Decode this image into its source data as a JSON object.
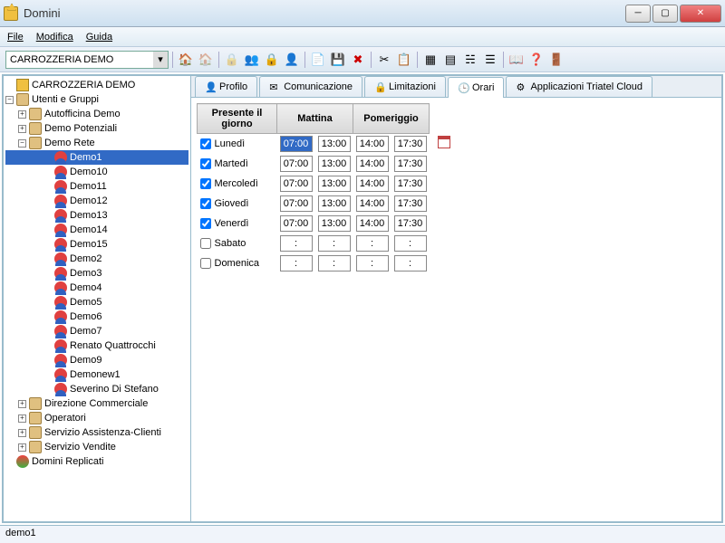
{
  "window": {
    "title": "Domini"
  },
  "menu": {
    "file": "File",
    "modifica": "Modifica",
    "guida": "Guida"
  },
  "toolbar": {
    "combo": "CARROZZERIA DEMO"
  },
  "tree": {
    "root": "CARROZZERIA DEMO",
    "utenti": "Utenti e Gruppi",
    "groups": [
      {
        "label": "Autofficina Demo"
      },
      {
        "label": "Demo Potenziali"
      },
      {
        "label": "Demo Rete",
        "expanded": true,
        "users": [
          "Demo1",
          "Demo10",
          "Demo11",
          "Demo12",
          "Demo13",
          "Demo14",
          "Demo15",
          "Demo2",
          "Demo3",
          "Demo4",
          "Demo5",
          "Demo6",
          "Demo7",
          "Renato Quattrocchi",
          "Demo9",
          "Demonew1",
          "Severino Di Stefano"
        ]
      },
      {
        "label": "Direzione Commerciale"
      },
      {
        "label": "Operatori"
      },
      {
        "label": "Servizio Assistenza-Clienti"
      },
      {
        "label": "Servizio Vendite"
      }
    ],
    "replicati": "Domini Replicati"
  },
  "tabs": {
    "profilo": "Profilo",
    "comunicazione": "Comunicazione",
    "limitazioni": "Limitazioni",
    "orari": "Orari",
    "cloud": "Applicazioni Triatel Cloud"
  },
  "schedule": {
    "headers": {
      "presente": "Presente il giorno",
      "mattina": "Mattina",
      "pomeriggio": "Pomeriggio"
    },
    "rows": [
      {
        "day": "Lunedì",
        "chk": true,
        "m1": "07:00",
        "m2": "13:00",
        "p1": "14:00",
        "p2": "17:30",
        "highlight": true
      },
      {
        "day": "Martedì",
        "chk": true,
        "m1": "07:00",
        "m2": "13:00",
        "p1": "14:00",
        "p2": "17:30"
      },
      {
        "day": "Mercoledì",
        "chk": true,
        "m1": "07:00",
        "m2": "13:00",
        "p1": "14:00",
        "p2": "17:30"
      },
      {
        "day": "Giovedì",
        "chk": true,
        "m1": "07:00",
        "m2": "13:00",
        "p1": "14:00",
        "p2": "17:30"
      },
      {
        "day": "Venerdì",
        "chk": true,
        "m1": "07:00",
        "m2": "13:00",
        "p1": "14:00",
        "p2": "17:30"
      },
      {
        "day": "Sabato",
        "chk": false,
        "m1": ":",
        "m2": ":",
        "p1": ":",
        "p2": ":"
      },
      {
        "day": "Domenica",
        "chk": false,
        "m1": ":",
        "m2": ":",
        "p1": ":",
        "p2": ":"
      }
    ]
  },
  "status": "demo1"
}
